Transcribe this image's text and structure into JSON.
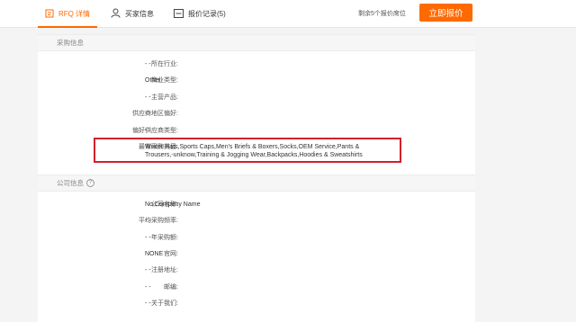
{
  "nav": {
    "tab_rfq": "RFQ 详情",
    "tab_buyer": "买家信息",
    "tab_quotes": "报价记录(5)",
    "remaining": "剩余5个报价席位",
    "quote_button": "立即报价"
  },
  "colors": {
    "accent": "#ff6a00",
    "highlight_border": "#d4202c"
  },
  "purchase_info": {
    "heading": "采购信息",
    "rows": [
      {
        "label": "所在行业:",
        "value": "- -"
      },
      {
        "label": "商业类型:",
        "value": "Other"
      },
      {
        "label": "主营产品:",
        "value": "- -"
      },
      {
        "label": "供应商地区偏好:",
        "value": "- -"
      },
      {
        "label": "偏好供应商类型:",
        "value": "- -"
      },
      {
        "label": "最常采购类目:",
        "value": "Winter Hats,Sports Caps,Men's Briefs & Boxers,Socks,OEM Service,Pants & Trousers,-unknow,Training & Jogging Wear,Backpacks,Hoodies & Sweatshirts"
      }
    ]
  },
  "company_info": {
    "heading": "公司信息",
    "help_icon": "question-circle-icon",
    "rows": [
      {
        "label": "公司名称:",
        "value": "No Company Name"
      },
      {
        "label": "平均采购频率:",
        "value": "- -"
      },
      {
        "label": "年采购额:",
        "value": "- -"
      },
      {
        "label": "官网:",
        "value": "NONE"
      },
      {
        "label": "注册地址:",
        "value": "- -"
      },
      {
        "label": "邮编:",
        "value": "- -"
      },
      {
        "label": "关于我们:",
        "value": "- -"
      }
    ]
  }
}
